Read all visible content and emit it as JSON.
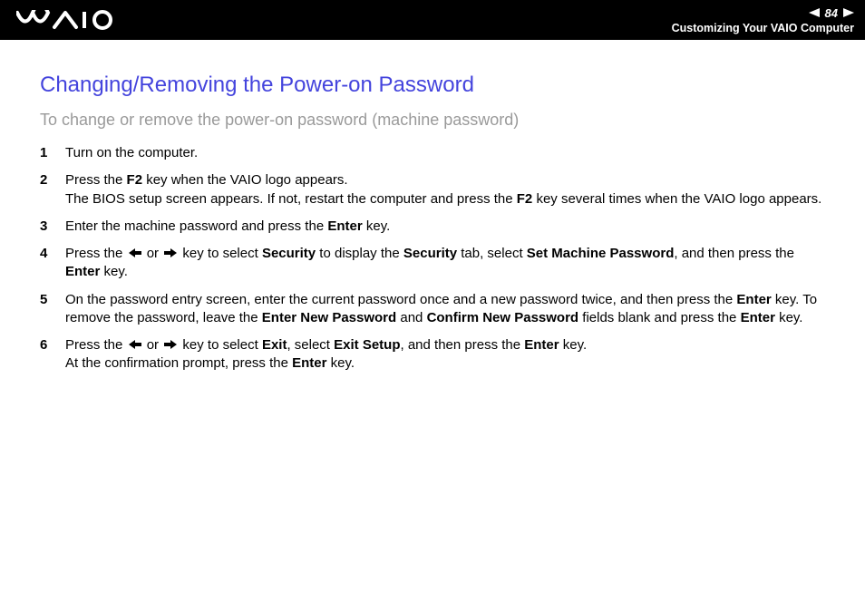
{
  "header": {
    "page_number": "84",
    "breadcrumb": "Customizing Your VAIO Computer"
  },
  "title": "Changing/Removing the Power-on Password",
  "subtitle": "To change or remove the power-on password (machine password)",
  "steps": [
    {
      "num": "1"
    },
    {
      "num": "2"
    },
    {
      "num": "3"
    },
    {
      "num": "4"
    },
    {
      "num": "5"
    },
    {
      "num": "6"
    }
  ],
  "step_text": {
    "s1": "Turn on the computer.",
    "s2a": "Press the ",
    "s2b": "F2",
    "s2c": " key when the VAIO logo appears.",
    "s2d": "The BIOS setup screen appears. If not, restart the computer and press the ",
    "s2e": "F2",
    "s2f": " key several times when the VAIO logo appears.",
    "s3a": "Enter the machine password and press the ",
    "s3b": "Enter",
    "s3c": " key.",
    "s4a": "Press the ",
    "s4b": " or ",
    "s4c": " key to select ",
    "s4d": "Security",
    "s4e": " to display the ",
    "s4f": "Security",
    "s4g": " tab, select ",
    "s4h": "Set Machine Password",
    "s4i": ", and then press the ",
    "s4j": "Enter",
    "s4k": " key.",
    "s5a": "On the password entry screen, enter the current password once and a new password twice, and then press the ",
    "s5b": "Enter",
    "s5c": " key. To remove the password, leave the ",
    "s5d": "Enter New Password",
    "s5e": " and ",
    "s5f": "Confirm New Password",
    "s5g": " fields blank and press the ",
    "s5h": "Enter",
    "s5i": " key.",
    "s6a": "Press the ",
    "s6b": " or ",
    "s6c": " key to select ",
    "s6d": "Exit",
    "s6e": ", select ",
    "s6f": "Exit Setup",
    "s6g": ", and then press the ",
    "s6h": "Enter",
    "s6i": " key.",
    "s6j": "At the confirmation prompt, press the ",
    "s6k": "Enter",
    "s6l": " key."
  }
}
